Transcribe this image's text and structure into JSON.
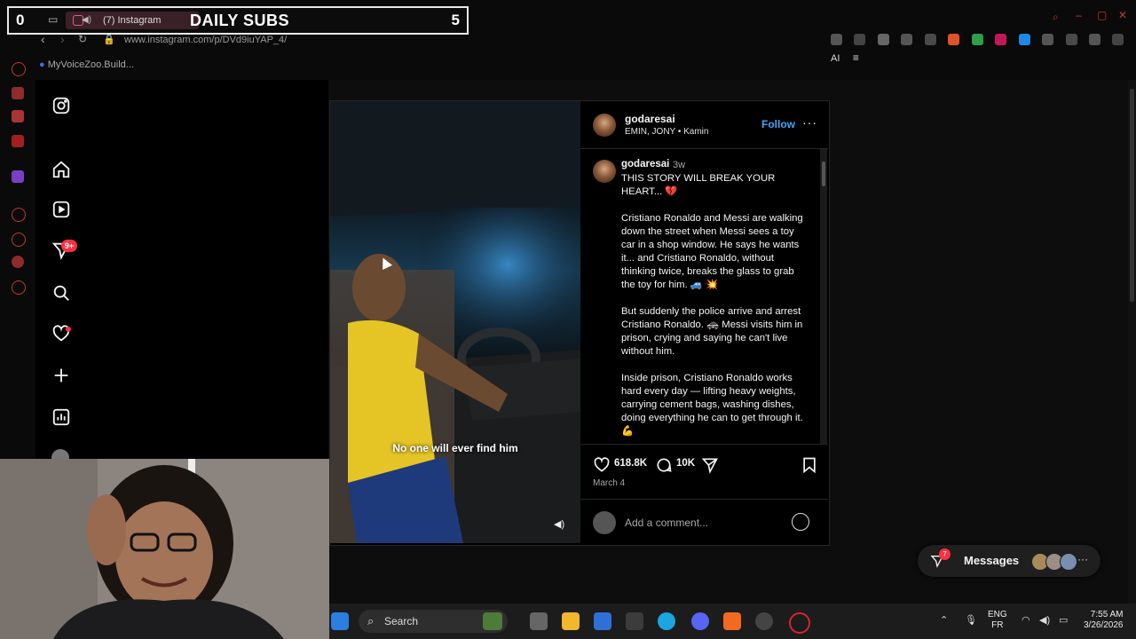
{
  "overlay": {
    "left_count": "0",
    "tab_title": "(7) Instagram",
    "banner": "DAILY SUBS",
    "right_count": "5"
  },
  "browser": {
    "url": "www.instagram.com/p/DVd9iuYAP_4/",
    "bookmark": "MyVoiceZoo.Build...",
    "ai_label": "AI"
  },
  "nav": {
    "notifications_badge": "9+"
  },
  "post": {
    "header_user": "godaresai",
    "header_music": "EMIN, JONY • Kamin",
    "follow_label": "Follow",
    "more_label": "···",
    "video_caption": "No one will ever find him",
    "caption_user": "godaresai",
    "caption_time": "3w",
    "caption_p1": "THIS STORY WILL BREAK YOUR HEART... 💔",
    "caption_p2": "Cristiano Ronaldo and Messi are walking down the street when Messi sees a toy car in a shop window. He says he wants it... and Cristiano Ronaldo, without thinking twice, breaks the glass to grab the toy for him. 🚙 💥",
    "caption_p3": "But suddenly the police arrive and arrest Cristiano Ronaldo. 🚓 Messi visits him in prison, crying and saying he can't live without him.",
    "caption_p4": "Inside prison, Cristiano Ronaldo works hard every day — lifting heavy weights, carrying cement bags, washing dishes, doing everything he can to get through it. 💪",
    "likes": "618.8K",
    "comments": "10K",
    "date": "March 4",
    "comment_placeholder": "Add a comment..."
  },
  "messages": {
    "label": "Messages",
    "badge": "7"
  },
  "taskbar": {
    "search_label": "Search",
    "lang_top": "ENG",
    "lang_bottom": "FR",
    "time": "7:55 AM",
    "date": "3/26/2026"
  }
}
